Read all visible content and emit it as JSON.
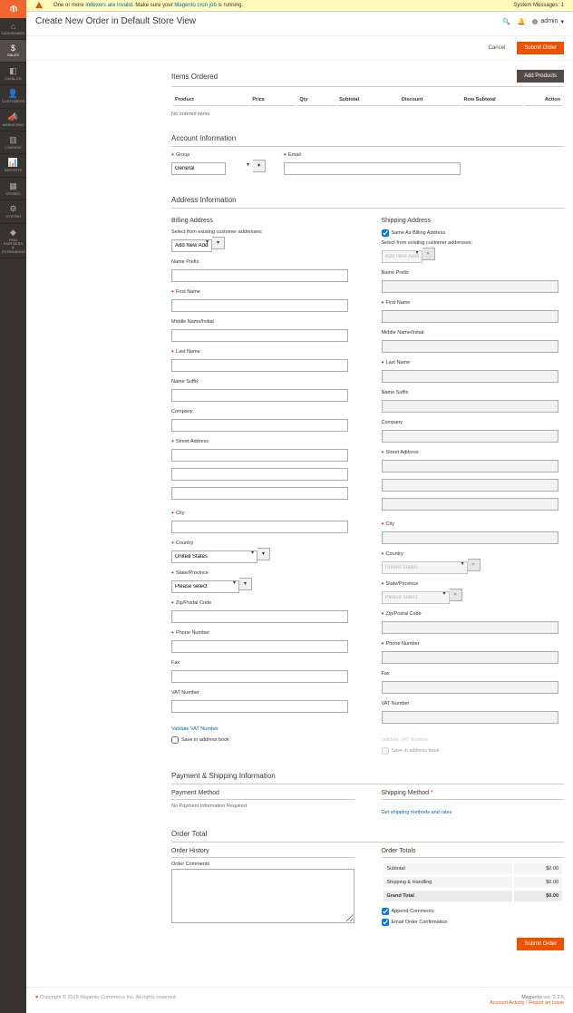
{
  "sysmsg": {
    "text_prefix": "One or more ",
    "link1": "indexers are invalid",
    "text_mid": ". Make sure your ",
    "link2": "Magento cron job",
    "text_suffix": " is running.",
    "right": "System Messages: 1"
  },
  "header": {
    "title": "Create New Order in Default Store View",
    "user": "admin"
  },
  "actions": {
    "cancel": "Cancel",
    "submit": "Submit Order",
    "add_products": "Add Products"
  },
  "sidebar": {
    "items": [
      {
        "label": "DASHBOARD",
        "icon": "⌂"
      },
      {
        "label": "SALES",
        "icon": "$"
      },
      {
        "label": "CATALOG",
        "icon": "◧"
      },
      {
        "label": "CUSTOMERS",
        "icon": "👤"
      },
      {
        "label": "MARKETING",
        "icon": "📣"
      },
      {
        "label": "CONTENT",
        "icon": "▥"
      },
      {
        "label": "REPORTS",
        "icon": "📊"
      },
      {
        "label": "STORES",
        "icon": "▦"
      },
      {
        "label": "SYSTEM",
        "icon": "⚙"
      },
      {
        "label": "FIND PARTNERS & EXTENSIONS",
        "icon": "◆"
      }
    ]
  },
  "sections": {
    "items_ordered": "Items Ordered",
    "account_info": "Account Information",
    "address_info": "Address Information",
    "payment_shipping": "Payment & Shipping Information",
    "order_total": "Order Total"
  },
  "items": {
    "headers": {
      "product": "Product",
      "price": "Price",
      "qty": "Qty",
      "subtotal": "Subtotal",
      "discount": "Discount",
      "row_subtotal": "Row Subtotal",
      "action": "Action"
    },
    "empty": "No ordered items"
  },
  "account": {
    "group_label": "Group",
    "group_value": "General",
    "email_label": "Email",
    "email_value": ""
  },
  "address": {
    "billing_title": "Billing Address",
    "shipping_title": "Shipping Address",
    "same_as_billing": "Same As Billing Address",
    "select_existing": "Select from existing customer addresses:",
    "add_new": "Add New Address",
    "labels": {
      "name_prefix": "Name Prefix",
      "first_name": "First Name",
      "middle": "Middle Name/Initial",
      "last_name": "Last Name",
      "name_suffix": "Name Suffix",
      "company": "Company",
      "street": "Street Address",
      "city": "City",
      "country": "Country",
      "state": "State/Province",
      "zip": "Zip/Postal Code",
      "phone": "Phone Number",
      "fax": "Fax",
      "vat": "VAT Number"
    },
    "country_value": "United States",
    "state_value": "Please select",
    "validate_vat": "Validate VAT Number",
    "save_book": "Save in address book"
  },
  "payment": {
    "method_title": "Payment Method",
    "no_payment": "No Payment Information Required",
    "shipping_title": "Shipping Method",
    "get_shipping": "Get shipping methods and rates"
  },
  "order_total": {
    "history_title": "Order History",
    "comments_label": "Order Comments",
    "totals_title": "Order Totals",
    "rows": {
      "subtotal": "Subtotal",
      "shipping": "Shipping & Handling",
      "grand": "Grand Total"
    },
    "values": {
      "subtotal": "$0.00",
      "shipping": "$0.00",
      "grand": "$0.00"
    },
    "append": "Append Comments",
    "email_conf": "Email Order Confirmation"
  },
  "footer": {
    "copyright": "Copyright © 2019 Magento Commerce Inc. All rights reserved.",
    "version_label": "Magento",
    "version": "ver. 2.2.6",
    "activity": "Account Activity",
    "report": "Report an Issue"
  }
}
